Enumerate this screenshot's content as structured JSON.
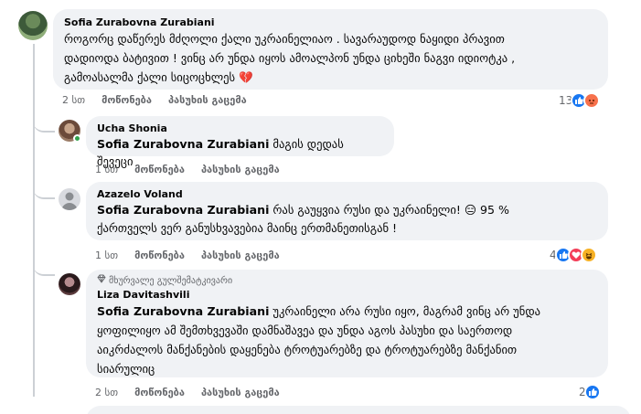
{
  "comments": [
    {
      "author": "Sofia Zurabovna Zurabiani",
      "text_lines": [
        "როგორც დაწერეს მძღოლი ქალი უკრაინელიაო . სავარაუდოდ ნაყიდი პრავით",
        "დადიოდა ბატივით ! ვინც არ უნდა იყოს ამოალპონ უნდა ციხეში ნაგვი იდიოტკა ,",
        "გამოასალმა ქალი სიცოცხლეს 💔"
      ],
      "time": "2 სთ",
      "like": "მოწონება",
      "reply": "პასუხის გაცემა",
      "reaction_count": "13"
    },
    {
      "author": "Ucha Shonia",
      "mention": "Sofia Zurabovna Zurabiani",
      "text": "მაგის დედას შევეცი",
      "time": "1 სთ",
      "like": "მოწონება",
      "reply": "პასუხის გაცემა"
    },
    {
      "author": "Azazelo Voland",
      "mention": "Sofia Zurabovna Zurabiani",
      "text_line1": "რას გაუყვია რუსი და უკრაინელი! 😑 95 %",
      "text_line2": "ქართველს ვერ განუსხვავებია მაინც ერთმანეთისგან !",
      "time": "1 სთ",
      "like": "მოწონება",
      "reply": "პასუხის გაცემა",
      "reaction_count": "4"
    },
    {
      "badge": "მხურვალე გულშემატკივარი",
      "author": "Liza Davitashvili",
      "mention": "Sofia Zurabovna Zurabiani",
      "text_line1": "უკრაინელი არა რუსი იყო, მაგრამ ვინც არ უნდა",
      "text_line2": "ყოფილიყო ამ შემთხვევაში დამნაშავეა და უნდა აგოს პასუხი და საერთოდ",
      "text_line3": "აიკრძალოს მანქანების დაყენება ტროტუარებზე და ტროტუარებზე მანქანით",
      "text_line4": "სიარულიც",
      "time": "2 სთ",
      "like": "მოწონება",
      "reply": "პასუხის გაცემა",
      "reaction_count": "2"
    }
  ],
  "colors": {
    "bubble": "#f0f2f5",
    "meta": "#65676b",
    "like": "#1877f2",
    "thread_line": "#ccd0d5"
  },
  "icons": [
    "like-icon",
    "love-icon",
    "angry-icon",
    "haha-icon",
    "diamond-icon"
  ]
}
